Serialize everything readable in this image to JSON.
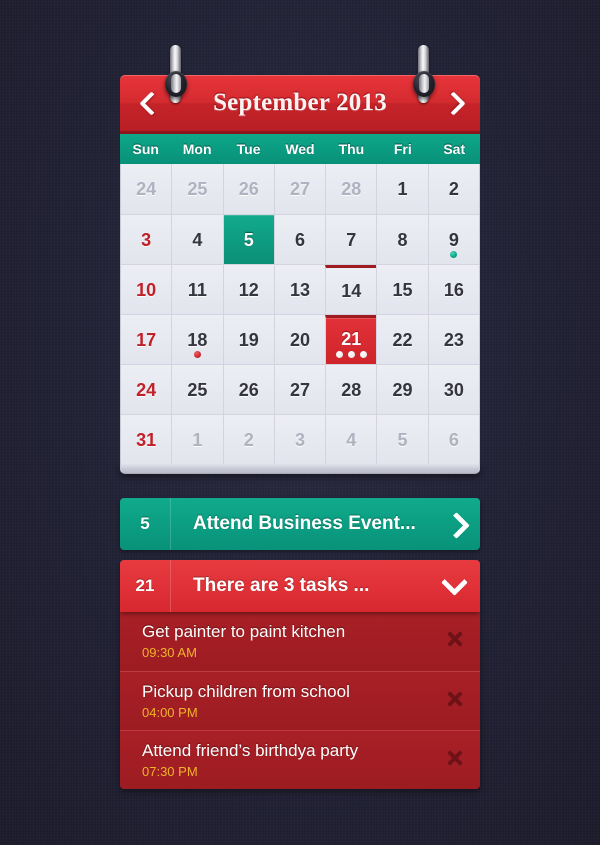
{
  "calendar": {
    "title": "September 2013",
    "prev_label": "‹",
    "next_label": "›",
    "weekdays": [
      "Sun",
      "Mon",
      "Tue",
      "Wed",
      "Thu",
      "Fri",
      "Sat"
    ],
    "weeks": [
      [
        {
          "num": "24",
          "state": "muted"
        },
        {
          "num": "25",
          "state": "muted"
        },
        {
          "num": "26",
          "state": "muted"
        },
        {
          "num": "27",
          "state": "muted"
        },
        {
          "num": "28",
          "state": "muted"
        },
        {
          "num": "1",
          "state": "normal"
        },
        {
          "num": "2",
          "state": "normal"
        }
      ],
      [
        {
          "num": "3",
          "state": "sunday"
        },
        {
          "num": "4",
          "state": "normal"
        },
        {
          "num": "5",
          "state": "selected-teal"
        },
        {
          "num": "6",
          "state": "normal"
        },
        {
          "num": "7",
          "state": "normal"
        },
        {
          "num": "8",
          "state": "normal"
        },
        {
          "num": "9",
          "state": "normal",
          "dots": [
            "teal"
          ]
        }
      ],
      [
        {
          "num": "10",
          "state": "sunday"
        },
        {
          "num": "11",
          "state": "normal"
        },
        {
          "num": "12",
          "state": "normal"
        },
        {
          "num": "13",
          "state": "normal"
        },
        {
          "num": "14",
          "state": "normal"
        },
        {
          "num": "15",
          "state": "normal"
        },
        {
          "num": "16",
          "state": "normal"
        }
      ],
      [
        {
          "num": "17",
          "state": "sunday"
        },
        {
          "num": "18",
          "state": "normal",
          "dots": [
            "red"
          ]
        },
        {
          "num": "19",
          "state": "normal"
        },
        {
          "num": "20",
          "state": "normal"
        },
        {
          "num": "21",
          "state": "selected-red",
          "dots": [
            "white",
            "white",
            "white"
          ]
        },
        {
          "num": "22",
          "state": "normal"
        },
        {
          "num": "23",
          "state": "normal"
        }
      ],
      [
        {
          "num": "24",
          "state": "sunday"
        },
        {
          "num": "25",
          "state": "normal"
        },
        {
          "num": "26",
          "state": "normal"
        },
        {
          "num": "27",
          "state": "normal"
        },
        {
          "num": "28",
          "state": "normal"
        },
        {
          "num": "29",
          "state": "normal"
        },
        {
          "num": "30",
          "state": "normal"
        }
      ],
      [
        {
          "num": "31",
          "state": "sunday"
        },
        {
          "num": "1",
          "state": "muted"
        },
        {
          "num": "2",
          "state": "muted"
        },
        {
          "num": "3",
          "state": "muted"
        },
        {
          "num": "4",
          "state": "muted"
        },
        {
          "num": "5",
          "state": "muted"
        },
        {
          "num": "6",
          "state": "muted"
        }
      ]
    ]
  },
  "event_bar": {
    "day": "5",
    "label": "Attend Business Event...",
    "chevron": "chevron-right-icon"
  },
  "tasks_bar": {
    "day": "21",
    "label": "There are 3 tasks ...",
    "chevron": "chevron-down-icon"
  },
  "tasks": [
    {
      "title": "Get painter to paint kitchen",
      "time": "09:30 AM",
      "close": "close-icon"
    },
    {
      "title": "Pickup children from school",
      "time": "04:00 PM",
      "close": "close-icon"
    },
    {
      "title": "Attend friend’s birthdya party",
      "time": "07:30 PM",
      "close": "close-icon"
    }
  ],
  "colors": {
    "background": "#232337",
    "header_red": "#d42b30",
    "weekday_teal": "#0ea789",
    "selected_teal": "#0b8f76",
    "selected_red": "#cf242b",
    "task_row_red": "#a82026",
    "task_time_yellow": "#f0b429",
    "grid_bg": "#e8e9f0",
    "sunday_red": "#c02028"
  }
}
